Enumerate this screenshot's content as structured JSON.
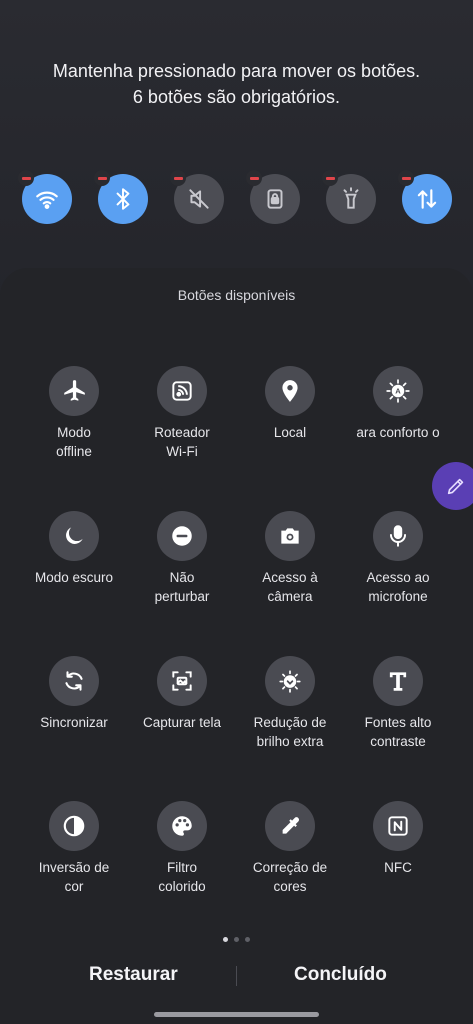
{
  "hint": {
    "line1": "Mantenha pressionado para mover os botões.",
    "line2": "6 botões são obrigatórios."
  },
  "active_buttons": [
    {
      "name": "wifi",
      "icon": "wifi-icon",
      "state": "on"
    },
    {
      "name": "bluetooth",
      "icon": "bluetooth-icon",
      "state": "on"
    },
    {
      "name": "sound",
      "icon": "mute-icon",
      "state": "off"
    },
    {
      "name": "rotation-lock",
      "icon": "lock-icon",
      "state": "off"
    },
    {
      "name": "flashlight",
      "icon": "flashlight-icon",
      "state": "off"
    },
    {
      "name": "mobile-data",
      "icon": "data-transfer-icon",
      "state": "on"
    }
  ],
  "panel": {
    "title": "Botões disponíveis",
    "tiles": [
      {
        "label": "Modo\noffline",
        "icon": "airplane-icon"
      },
      {
        "label": "Roteador\nWi-Fi",
        "icon": "hotspot-icon"
      },
      {
        "label": "Local",
        "icon": "location-icon"
      },
      {
        "label": "ara conforto o",
        "icon": "eye-comfort-icon"
      },
      {
        "label": "Modo escuro",
        "icon": "moon-icon"
      },
      {
        "label": "Não\nperturbar",
        "icon": "do-not-disturb-icon"
      },
      {
        "label": "Acesso à\ncâmera",
        "icon": "camera-icon"
      },
      {
        "label": "Acesso ao\nmicrofone",
        "icon": "microphone-icon"
      },
      {
        "label": "Sincronizar",
        "icon": "sync-icon"
      },
      {
        "label": "Capturar tela",
        "icon": "screenshot-icon"
      },
      {
        "label": "Redução de\nbrilho extra",
        "icon": "brightness-icon"
      },
      {
        "label": "Fontes alto\ncontraste",
        "icon": "font-contrast-icon"
      },
      {
        "label": "Inversão de\ncor",
        "icon": "invert-color-icon"
      },
      {
        "label": "Filtro\ncolorido",
        "icon": "palette-icon"
      },
      {
        "label": "Correção de\ncores",
        "icon": "eyedropper-icon"
      },
      {
        "label": "NFC",
        "icon": "nfc-icon"
      }
    ]
  },
  "page_indicator": {
    "pages": 3,
    "current": 1
  },
  "footer": {
    "reset": "Restaurar",
    "done": "Concluído"
  },
  "colors": {
    "accent": "#5aa0f2",
    "remove": "#e0454a",
    "edge_handle": "#5a3fb4"
  }
}
